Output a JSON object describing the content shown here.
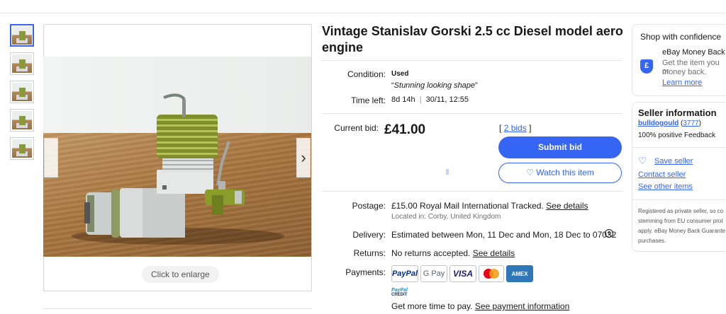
{
  "gallery": {
    "thumbnails": [
      "thumb-1",
      "thumb-2",
      "thumb-3",
      "thumb-4",
      "thumb-5"
    ],
    "enlarge_label": "Click to enlarge",
    "prev_icon": "chevron-left-icon",
    "next_icon": "chevron-right-icon",
    "next_glyph": "›"
  },
  "item": {
    "title": "Vintage Stanislav Gorski 2.5 cc Diesel model aero engine",
    "condition_label": "Condition:",
    "condition_value": "Used",
    "condition_note_open": "“",
    "condition_note": "Stunning looking shape",
    "condition_note_close": "”",
    "time_label": "Time left:",
    "time_left": "8d 14h",
    "time_sep": "|",
    "end_time": "30/11, 12:55",
    "current_bid_label": "Current bid:",
    "current_bid": "£41.00",
    "bids_open": "[",
    "bids_count": "2 bids",
    "bids_close": "]",
    "submit_bid_label": "Submit bid",
    "watch_label": "Watch this item",
    "watch_icon": "heart-outline-icon",
    "watch_glyph": "♡"
  },
  "shipping": {
    "postage_label": "Postage:",
    "postage_price": "£15.00",
    "postage_method": "Royal Mail International Tracked.",
    "see_details": "See details",
    "location": "Located in: Corby, United Kingdom",
    "delivery_label": "Delivery:",
    "delivery_text": "Estimated between Mon, 11 Dec and Mon, 18 Dec to 07032",
    "info_icon": "info-circle-icon",
    "info_glyph": "i",
    "returns_label": "Returns:",
    "returns_text": "No returns accepted.",
    "returns_link": "See details"
  },
  "payments": {
    "label": "Payments:",
    "methods": [
      "PayPal",
      "G Pay",
      "VISA",
      "Mastercard",
      "AMEX"
    ],
    "credit_logo_top": "PayPal",
    "credit_logo_bottom": "CREDIT",
    "more_time_text": "Get more time to pay.",
    "more_time_link": "See payment information"
  },
  "shop_confidence": {
    "title": "Shop with confidence",
    "guarantee_title": "eBay Money Back",
    "guarantee_line1": "Get the item you or",
    "guarantee_line2": "money back.",
    "learn_more": "Learn more",
    "shield_icon": "pound-shield-icon",
    "shield_glyph": "£"
  },
  "seller": {
    "header": "Seller information",
    "name": "bulldogould",
    "feedback_open": "(",
    "feedback_score": "3777",
    "feedback_close": ")",
    "positive": "100% positive Feedback",
    "save_seller": "Save seller",
    "heart_glyph": "♡",
    "contact_seller": "Contact seller",
    "other_items": "See other items",
    "note_line1": "Registered as private seller, so co",
    "note_line2": "stemming from EU consumer prot",
    "note_line3": "apply. eBay Money Back Guarante",
    "note_line4": "purchases."
  },
  "colors": {
    "accent": "#3665f3",
    "text": "#191919",
    "muted": "#707070",
    "paypal_blue": "#003087",
    "visa_blue": "#1a1f71",
    "amex_blue": "#2e77bb",
    "mastercard_red": "#eb001b",
    "mastercard_orange": "#f79e1b"
  }
}
